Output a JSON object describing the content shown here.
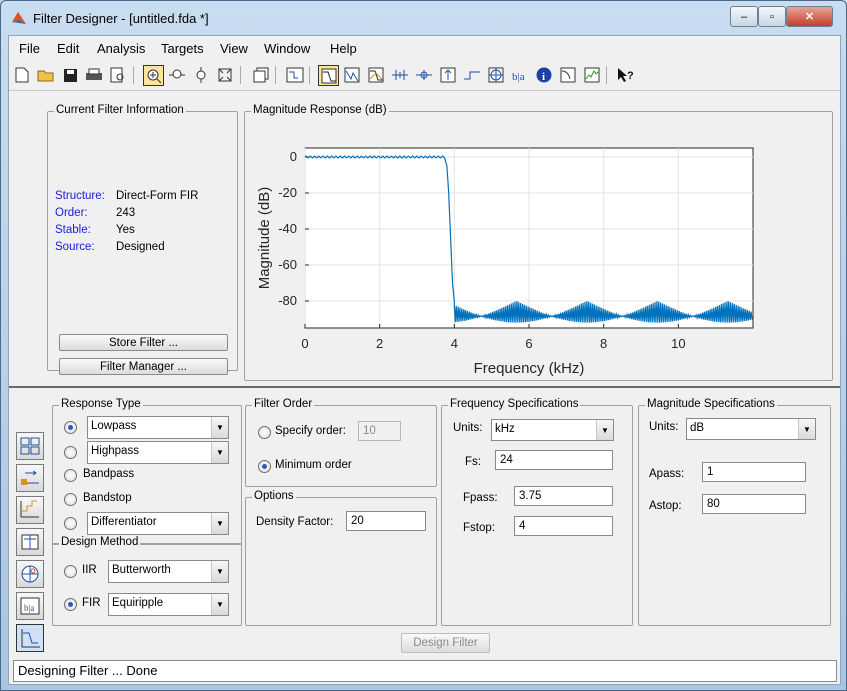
{
  "window": {
    "title": "Filter Designer -  [untitled.fda *]",
    "controls": [
      "–",
      "▫",
      "✕"
    ]
  },
  "menu": [
    "File",
    "Edit",
    "Analysis",
    "Targets",
    "View",
    "Window",
    "Help"
  ],
  "filter_info": {
    "title": "Current Filter Information",
    "rows": [
      {
        "key": "Structure:",
        "value": "Direct-Form FIR"
      },
      {
        "key": "Order:",
        "value": "243"
      },
      {
        "key": "Stable:",
        "value": "Yes"
      },
      {
        "key": "Source:",
        "value": "Designed"
      }
    ],
    "store_button": "Store Filter ...",
    "manager_button": "Filter Manager ..."
  },
  "chart_data": {
    "type": "line",
    "title": "Magnitude Response (dB)",
    "xlabel": "Frequency (kHz)",
    "ylabel": "Magnitude (dB)",
    "xlim": [
      0,
      12
    ],
    "ylim": [
      -95,
      5
    ],
    "xticks": [
      0,
      2,
      4,
      6,
      8,
      10
    ],
    "yticks": [
      0,
      -20,
      -40,
      -60,
      -80
    ],
    "xticklabels": [
      "0",
      "2",
      "4",
      "6",
      "8",
      "10"
    ],
    "yticklabels": [
      "0",
      "-20",
      "-40",
      "-60",
      "-80"
    ],
    "grid": true,
    "color": "#0072bd",
    "series": [
      {
        "x": [
          0,
          3.75,
          3.8,
          3.85,
          3.9,
          3.95,
          4.0,
          12.0
        ],
        "y": [
          0,
          0,
          -5,
          -20,
          -45,
          -70,
          -80,
          -80
        ]
      }
    ],
    "passband_ripple_db": 1,
    "stopband_attenuation_db": 80
  },
  "response_type": {
    "title": "Response Type",
    "options": [
      {
        "label": "Lowpass",
        "dropdown": true,
        "selected": true
      },
      {
        "label": "Highpass",
        "dropdown": true,
        "selected": false
      },
      {
        "label": "Bandpass",
        "dropdown": false,
        "selected": false
      },
      {
        "label": "Bandstop",
        "dropdown": false,
        "selected": false
      },
      {
        "label": "Differentiator",
        "dropdown": true,
        "selected": false
      }
    ]
  },
  "design_method": {
    "title": "Design Method",
    "iir_label": "IIR",
    "iir_value": "Butterworth",
    "fir_label": "FIR",
    "fir_value": "Equiripple"
  },
  "filter_order": {
    "title": "Filter Order",
    "specify_label": "Specify order:",
    "specify_value": "10",
    "minimum_label": "Minimum order"
  },
  "options": {
    "title": "Options",
    "density_label": "Density Factor:",
    "density_value": "20"
  },
  "freq_specs": {
    "title": "Frequency Specifications",
    "units_label": "Units:",
    "units_value": "kHz",
    "fs_label": "Fs:",
    "fs_value": "24",
    "fpass_label": "Fpass:",
    "fpass_value": "3.75",
    "fstop_label": "Fstop:",
    "fstop_value": "4"
  },
  "mag_specs": {
    "title": "Magnitude Specifications",
    "units_label": "Units:",
    "units_value": "dB",
    "apass_label": "Apass:",
    "apass_value": "1",
    "astop_label": "Astop:",
    "astop_value": "80"
  },
  "design_button": "Design Filter",
  "status": "Designing Filter ... Done"
}
